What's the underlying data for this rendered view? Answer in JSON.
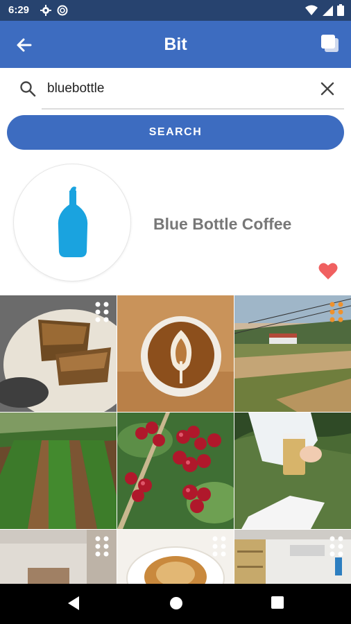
{
  "status_bar": {
    "time": "6:29",
    "icons": [
      "settings-icon",
      "sync-icon",
      "wifi-icon",
      "signal-icon",
      "battery-icon"
    ],
    "color": "#27436f"
  },
  "app_bar": {
    "title": "Bit",
    "back_icon": "arrow-left-icon",
    "action_icon": "copy-icon",
    "color": "#3d6cc0"
  },
  "search": {
    "query": "bluebottle",
    "search_icon": "magnifier-icon",
    "clear_icon": "close-icon",
    "button_label": "SEARCH"
  },
  "profile": {
    "name": "Blue Bottle Coffee",
    "logo": "blue-bottle-logo",
    "favorite_icon": "heart-icon",
    "favorite_color": "#f06060",
    "logo_color": "#1aa3df"
  },
  "grid": {
    "tiles": [
      {
        "subject": "banana bread slices on plate",
        "badge_color": "#ffffff"
      },
      {
        "subject": "latte art in cup",
        "badge_color": null
      },
      {
        "subject": "hillside farm landscape",
        "badge_color": "#f0922d"
      },
      {
        "subject": "coffee farm rows",
        "badge_color": null
      },
      {
        "subject": "red coffee cherries",
        "badge_color": null
      },
      {
        "subject": "hand holding iced coffee",
        "badge_color": null
      },
      {
        "subject": "cafe interior wall",
        "badge_color": "#ffffff"
      },
      {
        "subject": "pastry on plate",
        "badge_color": "#ffffff"
      },
      {
        "subject": "cafe shelves interior",
        "badge_color": "#ffffff"
      }
    ]
  },
  "nav_bar": {
    "buttons": [
      "back-triangle-icon",
      "home-circle-icon",
      "recents-square-icon"
    ]
  }
}
